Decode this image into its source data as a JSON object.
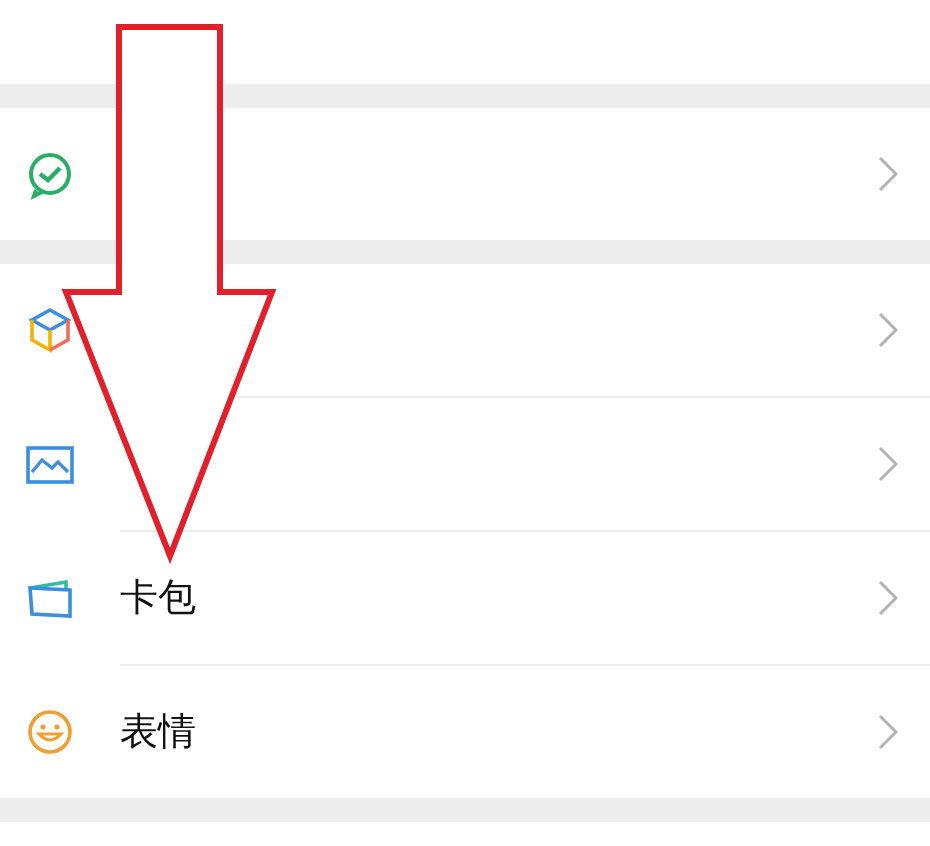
{
  "groups": [
    {
      "items": [
        {
          "kind": "pay"
        }
      ]
    },
    {
      "items": [
        {
          "kind": "favorites"
        },
        {
          "kind": "album"
        },
        {
          "kind": "cards",
          "label": "卡包"
        },
        {
          "kind": "stickers",
          "label": "表情"
        }
      ]
    }
  ],
  "annotation": {
    "kind": "arrow"
  }
}
